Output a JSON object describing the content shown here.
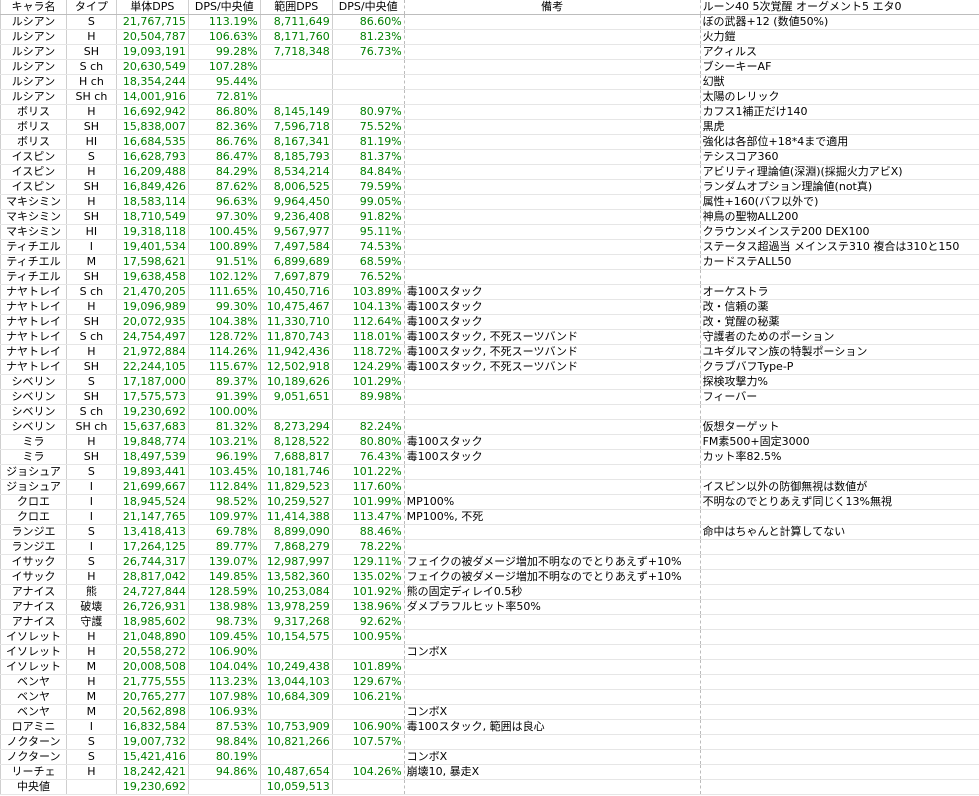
{
  "headers": [
    "キャラ名",
    "タイプ",
    "単体DPS",
    "DPS/中央値",
    "範囲DPS",
    "DPS/中央値",
    "備考",
    "ルーン40 5次覚醒 オーグメント5 エタ0"
  ],
  "rows": [
    [
      "ルシアン",
      "S",
      "21,767,715",
      "113.19%",
      "8,711,649",
      "86.60%",
      "",
      "ぼの武器+12 (数値50%)"
    ],
    [
      "ルシアン",
      "H",
      "20,504,787",
      "106.63%",
      "8,171,760",
      "81.23%",
      "",
      "火力鎧"
    ],
    [
      "ルシアン",
      "SH",
      "19,093,191",
      "99.28%",
      "7,718,348",
      "76.73%",
      "",
      "アクィルス"
    ],
    [
      "ルシアン",
      "S ch",
      "20,630,549",
      "107.28%",
      "",
      "",
      "",
      "ブシーキーAF"
    ],
    [
      "ルシアン",
      "H ch",
      "18,354,244",
      "95.44%",
      "",
      "",
      "",
      "幻獣"
    ],
    [
      "ルシアン",
      "SH ch",
      "14,001,916",
      "72.81%",
      "",
      "",
      "",
      "太陽のレリック"
    ],
    [
      "ボリス",
      "H",
      "16,692,942",
      "86.80%",
      "8,145,149",
      "80.97%",
      "",
      "カフス1補正だけ140"
    ],
    [
      "ボリス",
      "SH",
      "15,838,007",
      "82.36%",
      "7,596,718",
      "75.52%",
      "",
      "黒虎"
    ],
    [
      "ボリス",
      "HI",
      "16,684,535",
      "86.76%",
      "8,167,341",
      "81.19%",
      "",
      "強化は各部位+18*4まで適用"
    ],
    [
      "イスピン",
      "S",
      "16,628,793",
      "86.47%",
      "8,185,793",
      "81.37%",
      "",
      "テシスコア360"
    ],
    [
      "イスピン",
      "H",
      "16,209,488",
      "84.29%",
      "8,534,214",
      "84.84%",
      "",
      "アビリティ理論値(深淵)(採掘火力アビX)"
    ],
    [
      "イスピン",
      "SH",
      "16,849,426",
      "87.62%",
      "8,006,525",
      "79.59%",
      "",
      "ランダムオプション理論値(not真)"
    ],
    [
      "マキシミン",
      "H",
      "18,583,114",
      "96.63%",
      "9,964,450",
      "99.05%",
      "",
      "属性+160(バフ以外で)"
    ],
    [
      "マキシミン",
      "SH",
      "18,710,549",
      "97.30%",
      "9,236,408",
      "91.82%",
      "",
      "神鳥の聖物ALL200"
    ],
    [
      "マキシミン",
      "HI",
      "19,318,118",
      "100.45%",
      "9,567,977",
      "95.11%",
      "",
      "クラウンメインステ200 DEX100"
    ],
    [
      "ティチエル",
      "I",
      "19,401,534",
      "100.89%",
      "7,497,584",
      "74.53%",
      "",
      "ステータス超過当 メインステ310 複合は310と150"
    ],
    [
      "ティチエル",
      "M",
      "17,598,621",
      "91.51%",
      "6,899,689",
      "68.59%",
      "",
      "カードステALL50"
    ],
    [
      "ティチエル",
      "SH",
      "19,638,458",
      "102.12%",
      "7,697,879",
      "76.52%",
      "",
      ""
    ],
    [
      "ナヤトレイ",
      "S ch",
      "21,470,205",
      "111.65%",
      "10,450,716",
      "103.89%",
      "毒100スタック",
      "オーケストラ"
    ],
    [
      "ナヤトレイ",
      "H",
      "19,096,989",
      "99.30%",
      "10,475,467",
      "104.13%",
      "毒100スタック",
      "改・信頼の薬"
    ],
    [
      "ナヤトレイ",
      "SH",
      "20,072,935",
      "104.38%",
      "11,330,710",
      "112.64%",
      "毒100スタック",
      "改・覚醒の秘薬"
    ],
    [
      "ナヤトレイ",
      "S ch",
      "24,754,497",
      "128.72%",
      "11,870,743",
      "118.01%",
      "毒100スタック, 不死スーツバンド",
      "守護者のためのポーション"
    ],
    [
      "ナヤトレイ",
      "H",
      "21,972,884",
      "114.26%",
      "11,942,436",
      "118.72%",
      "毒100スタック, 不死スーツバンド",
      "ユキダルマン族の特製ポーション"
    ],
    [
      "ナヤトレイ",
      "SH",
      "22,244,105",
      "115.67%",
      "12,502,918",
      "124.29%",
      "毒100スタック, 不死スーツバンド",
      "クラブバフType-P"
    ],
    [
      "シベリン",
      "S",
      "17,187,000",
      "89.37%",
      "10,189,626",
      "101.29%",
      "",
      "探検攻撃力%"
    ],
    [
      "シベリン",
      "SH",
      "17,575,573",
      "91.39%",
      "9,051,651",
      "89.98%",
      "",
      "フィーバー"
    ],
    [
      "シベリン",
      "S ch",
      "19,230,692",
      "100.00%",
      "",
      "",
      "",
      ""
    ],
    [
      "シベリン",
      "SH ch",
      "15,637,683",
      "81.32%",
      "8,273,294",
      "82.24%",
      "",
      "仮想ターゲット"
    ],
    [
      "ミラ",
      "H",
      "19,848,774",
      "103.21%",
      "8,128,522",
      "80.80%",
      "毒100スタック",
      "FM素500+固定3000"
    ],
    [
      "ミラ",
      "SH",
      "18,497,539",
      "96.19%",
      "7,688,817",
      "76.43%",
      "毒100スタック",
      "カット率82.5%"
    ],
    [
      "ジョシュア",
      "S",
      "19,893,441",
      "103.45%",
      "10,181,746",
      "101.22%",
      "",
      ""
    ],
    [
      "ジョシュア",
      "I",
      "21,699,667",
      "112.84%",
      "11,829,523",
      "117.60%",
      "",
      "イスピン以外の防御無視は数値が"
    ],
    [
      "クロエ",
      "I",
      "18,945,524",
      "98.52%",
      "10,259,527",
      "101.99%",
      "MP100%",
      "不明なのでとりあえず同じく13%無視"
    ],
    [
      "クロエ",
      "I",
      "21,147,765",
      "109.97%",
      "11,414,388",
      "113.47%",
      "MP100%, 不死",
      ""
    ],
    [
      "ランジエ",
      "S",
      "13,418,413",
      "69.78%",
      "8,899,090",
      "88.46%",
      "",
      "命中はちゃんと計算してない"
    ],
    [
      "ランジエ",
      "I",
      "17,264,125",
      "89.77%",
      "7,868,279",
      "78.22%",
      "",
      ""
    ],
    [
      "イサック",
      "S",
      "26,744,317",
      "139.07%",
      "12,987,997",
      "129.11%",
      "フェイクの被ダメージ増加不明なのでとりあえず+10%",
      ""
    ],
    [
      "イサック",
      "H",
      "28,817,042",
      "149.85%",
      "13,582,360",
      "135.02%",
      "フェイクの被ダメージ増加不明なのでとりあえず+10%",
      ""
    ],
    [
      "アナイス",
      "熊",
      "24,727,844",
      "128.59%",
      "10,253,084",
      "101.92%",
      "熊の固定ディレイ0.5秒",
      ""
    ],
    [
      "アナイス",
      "破壊",
      "26,726,931",
      "138.98%",
      "13,978,259",
      "138.96%",
      "ダメプラフルヒット率50%",
      ""
    ],
    [
      "アナイス",
      "守護",
      "18,985,602",
      "98.73%",
      "9,317,268",
      "92.62%",
      "",
      ""
    ],
    [
      "イソレット",
      "H",
      "21,048,890",
      "109.45%",
      "10,154,575",
      "100.95%",
      "",
      ""
    ],
    [
      "イソレット",
      "H",
      "20,558,272",
      "106.90%",
      "",
      "",
      "コンボX",
      ""
    ],
    [
      "イソレット",
      "M",
      "20,008,508",
      "104.04%",
      "10,249,438",
      "101.89%",
      "",
      ""
    ],
    [
      "ベンヤ",
      "H",
      "21,775,555",
      "113.23%",
      "13,044,103",
      "129.67%",
      "",
      ""
    ],
    [
      "ベンヤ",
      "M",
      "20,765,277",
      "107.98%",
      "10,684,309",
      "106.21%",
      "",
      ""
    ],
    [
      "ベンヤ",
      "M",
      "20,562,898",
      "106.93%",
      "",
      "",
      "コンボX",
      ""
    ],
    [
      "ロアミニ",
      "I",
      "16,832,584",
      "87.53%",
      "10,753,909",
      "106.90%",
      "毒100スタック, 範囲は良心",
      ""
    ],
    [
      "ノクターン",
      "S",
      "19,007,732",
      "98.84%",
      "10,821,266",
      "107.57%",
      "",
      ""
    ],
    [
      "ノクターン",
      "S",
      "15,421,416",
      "80.19%",
      "",
      "",
      "コンボX",
      ""
    ],
    [
      "リーチェ",
      "H",
      "18,242,421",
      "94.86%",
      "10,487,654",
      "104.26%",
      "崩壊10, 暴走X",
      ""
    ]
  ],
  "median": {
    "label": "中央値",
    "single": "19,230,692",
    "range": "10,059,513"
  }
}
